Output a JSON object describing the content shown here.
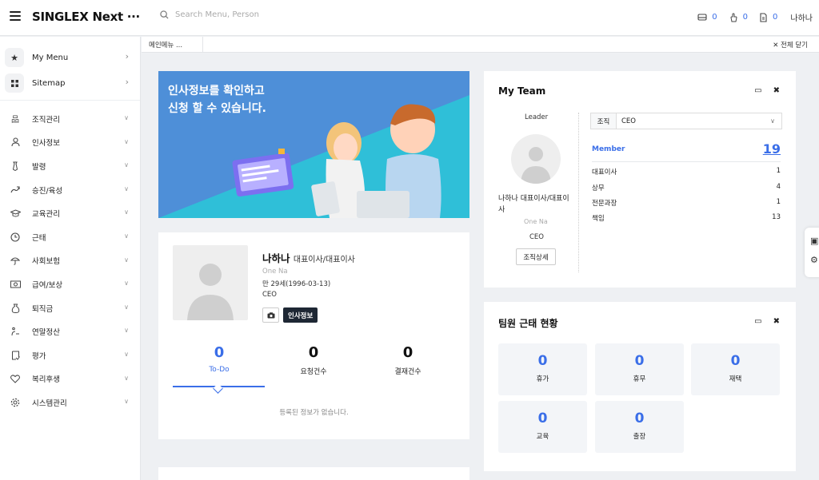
{
  "header": {
    "brand": "SINGLEX Next ···",
    "search_placeholder": "Search Menu, Person",
    "counters": [
      {
        "icon": "inbox-icon",
        "value": "0"
      },
      {
        "icon": "hand-icon",
        "value": "0"
      },
      {
        "icon": "document-icon",
        "value": "0"
      }
    ],
    "user": "나하나"
  },
  "sidebar": {
    "top": [
      {
        "label": "My Menu",
        "icon": "star-icon"
      },
      {
        "label": "Sitemap",
        "icon": "grid-icon"
      }
    ],
    "items": [
      {
        "label": "조직관리",
        "icon": "org-chart-icon"
      },
      {
        "label": "인사정보",
        "icon": "person-icon"
      },
      {
        "label": "발령",
        "icon": "tie-icon"
      },
      {
        "label": "승진/육성",
        "icon": "growth-icon"
      },
      {
        "label": "교육관리",
        "icon": "graduation-cap-icon"
      },
      {
        "label": "근태",
        "icon": "clock-icon"
      },
      {
        "label": "사회보험",
        "icon": "umbrella-icon"
      },
      {
        "label": "급여/보상",
        "icon": "money-icon"
      },
      {
        "label": "퇴직금",
        "icon": "pouch-icon"
      },
      {
        "label": "연말정산",
        "icon": "calculator-icon"
      },
      {
        "label": "평가",
        "icon": "evaluation-icon"
      },
      {
        "label": "복리후생",
        "icon": "heart-icon"
      },
      {
        "label": "시스템관리",
        "icon": "gear-icon"
      }
    ]
  },
  "tabs": {
    "main": "메인메뉴 ...",
    "close_all": "전체 닫기"
  },
  "banner": {
    "line1": "인사정보를 확인하고",
    "line2": "신청 할 수 있습니다."
  },
  "profile": {
    "name": "나하나",
    "title": "대표이사/대표이사",
    "name_en": "One Na",
    "age": "만 29세(1996-03-13)",
    "position": "CEO",
    "info_button": "인사정보",
    "stats": [
      {
        "value": "0",
        "label": "To-Do"
      },
      {
        "value": "0",
        "label": "요청건수"
      },
      {
        "value": "0",
        "label": "결재건수"
      }
    ],
    "empty_message": "등록된 정보가 없습니다."
  },
  "my_team": {
    "title": "My Team",
    "leader_label": "Leader",
    "leader_name": "나하나 대표이사/대표이사",
    "leader_en": "One Na",
    "leader_position": "CEO",
    "org_detail_button": "조직상세",
    "org_select_label": "조직",
    "org_select_value": "CEO",
    "member_label": "Member",
    "member_count": "19",
    "roles": [
      {
        "label": "대표이사",
        "count": "1"
      },
      {
        "label": "상무",
        "count": "4"
      },
      {
        "label": "전문과장",
        "count": "1"
      },
      {
        "label": "책임",
        "count": "13"
      }
    ]
  },
  "attendance": {
    "title": "팀원 근태 현황",
    "items": [
      {
        "value": "0",
        "label": "휴가"
      },
      {
        "value": "0",
        "label": "휴무"
      },
      {
        "value": "0",
        "label": "재택"
      },
      {
        "value": "0",
        "label": "교육"
      },
      {
        "value": "0",
        "label": "출장"
      }
    ]
  },
  "colors": {
    "accent": "#3a6ee8",
    "dark_button": "#1e2734",
    "banner_blue": "#4e8fd8",
    "banner_teal": "#2fbfd8"
  }
}
